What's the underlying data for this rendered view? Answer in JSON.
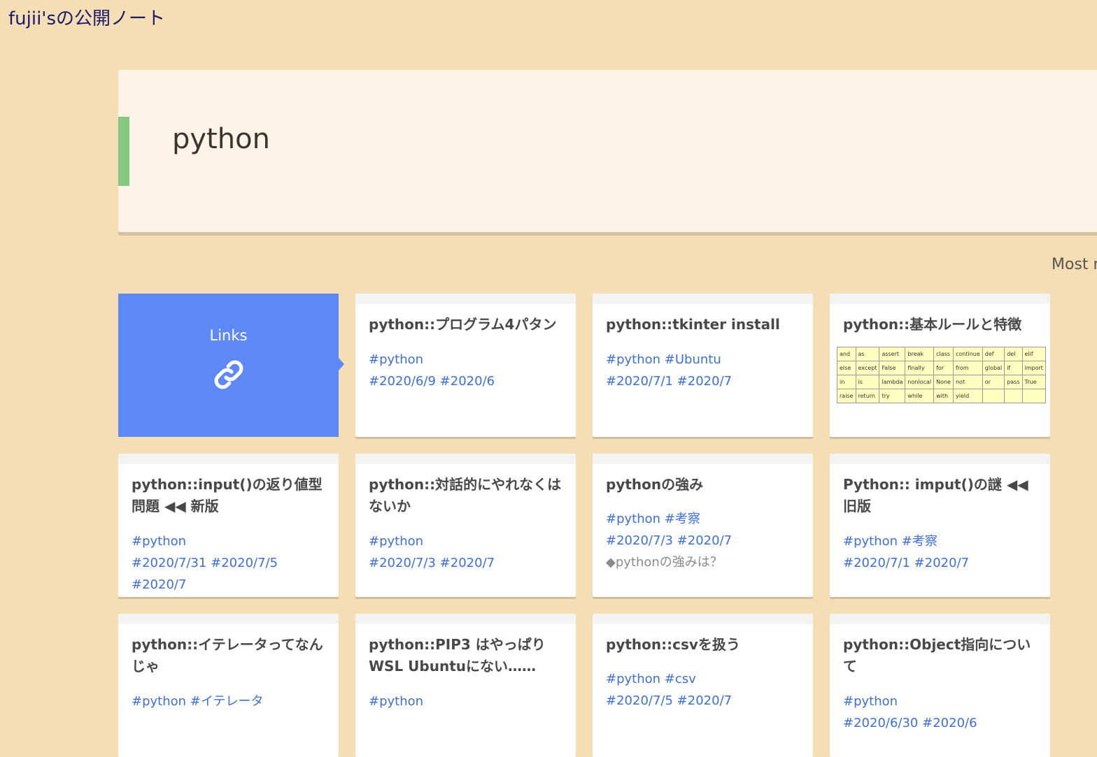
{
  "site": {
    "title": "fujii'sの公開ノート"
  },
  "page": {
    "title": "python"
  },
  "sort": {
    "label": "Most r"
  },
  "links_card": {
    "label": "Links",
    "icon": "link-icon"
  },
  "cards": [
    {
      "title": "python::プログラム4パタン",
      "tags": [
        "#python"
      ],
      "dates": [
        "#2020/6/9",
        "#2020/6"
      ]
    },
    {
      "title": "python::tkinter install",
      "tags": [
        "#python",
        "#Ubuntu"
      ],
      "dates": [
        "#2020/7/1",
        "#2020/7"
      ]
    },
    {
      "title": "python::基本ルールと特徴",
      "keywords": [
        [
          "and",
          "as",
          "assert",
          "break",
          "class",
          "continue",
          "def",
          "del",
          "elif"
        ],
        [
          "else",
          "except",
          "False",
          "finally",
          "for",
          "from",
          "global",
          "if",
          "import"
        ],
        [
          "in",
          "is",
          "lambda",
          "nonlocal",
          "None",
          "not",
          "or",
          "pass",
          "True"
        ],
        [
          "raise",
          "return",
          "try",
          "while",
          "with",
          "yield",
          "",
          "",
          ""
        ]
      ]
    },
    {
      "title": "python::input()の返り値型問題 ◀◀ 新版",
      "tags": [
        "#python"
      ],
      "dates": [
        "#2020/7/31",
        "#2020/7/5",
        "#2020/7"
      ]
    },
    {
      "title": "python::対話的にやれなくはないか",
      "tags": [
        "#python"
      ],
      "dates": [
        "#2020/7/3",
        "#2020/7"
      ]
    },
    {
      "title": "pythonの強み",
      "tags": [
        "#python",
        "#考察"
      ],
      "dates": [
        "#2020/7/3",
        "#2020/7"
      ],
      "description": "◆pythonの強みは？"
    },
    {
      "title": "Python:: imput()の謎 ◀◀ 旧版",
      "tags": [
        "#python",
        "#考察"
      ],
      "dates": [
        "#2020/7/1",
        "#2020/7"
      ]
    },
    {
      "title": "python::イテレータってなんじゃ",
      "tags": [
        "#python",
        "#イテレータ"
      ],
      "dates": []
    },
    {
      "title": "python::PIP3 はやっぱりWSL Ubuntuにない……",
      "tags": [
        "#python"
      ],
      "dates": []
    },
    {
      "title": "python::csvを扱う",
      "tags": [
        "#python",
        "#csv"
      ],
      "dates": [
        "#2020/7/5",
        "#2020/7"
      ]
    },
    {
      "title": "python::Object指向について",
      "tags": [
        "#python"
      ],
      "dates": [
        "#2020/6/30",
        "#2020/6"
      ]
    }
  ]
}
